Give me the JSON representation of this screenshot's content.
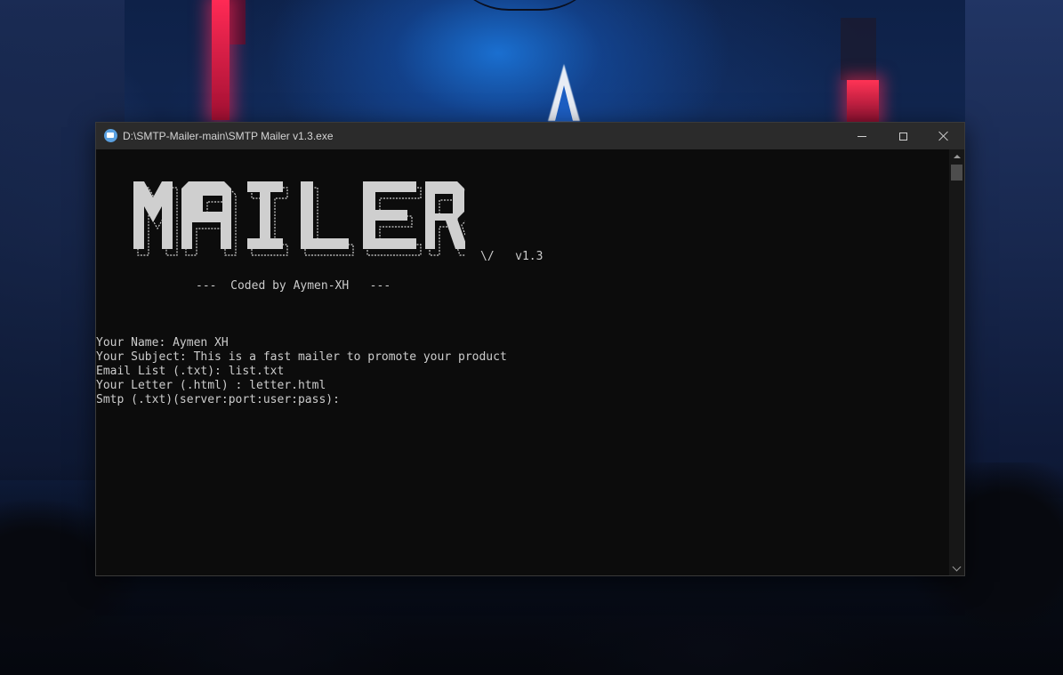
{
  "window": {
    "title": "D:\\SMTP-Mailer-main\\SMTP Mailer v1.3.exe",
    "icon": "mail-app-icon"
  },
  "banner": {
    "logo_text": "MAILER",
    "version": "\\/   v1.3",
    "credit": "---  Coded by Aymen-XH   ---"
  },
  "output": {
    "lines": [
      "Your Name: Aymen XH",
      "Your Subject: This is a fast mailer to promote your product",
      "Email List (.txt): list.txt",
      "Your Letter (.html) : letter.html",
      "Smtp (.txt)(server:port:user:pass):"
    ]
  },
  "colors": {
    "console_bg": "#0c0c0c",
    "console_text": "#cccccc",
    "titlebar_bg": "#2b2b2b",
    "logo_fill": "#d0d0d0"
  }
}
